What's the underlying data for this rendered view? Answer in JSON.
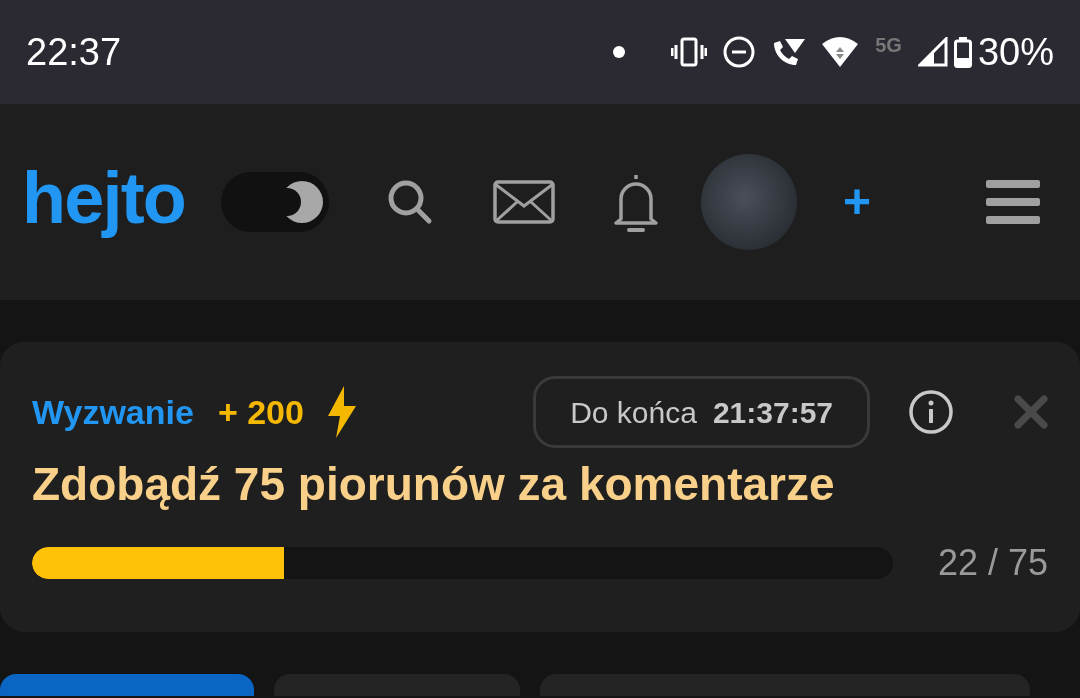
{
  "status_bar": {
    "time": "22:37",
    "network": "5G",
    "battery": "30%"
  },
  "header": {
    "logo": "hejto",
    "dark_mode": {
      "on": true
    },
    "new_button": "+"
  },
  "challenge": {
    "label": "Wyzwanie",
    "reward": "+ 200",
    "countdown_label": "Do końca",
    "countdown": "21:37:57",
    "title": "Zdobądź 75 piorunów za komentarze",
    "level": 0.293,
    "progress": "22 / 75"
  },
  "category_tabs": [
    {
      "selected": true
    },
    {
      "selected": false
    },
    {
      "selected": false
    }
  ]
}
